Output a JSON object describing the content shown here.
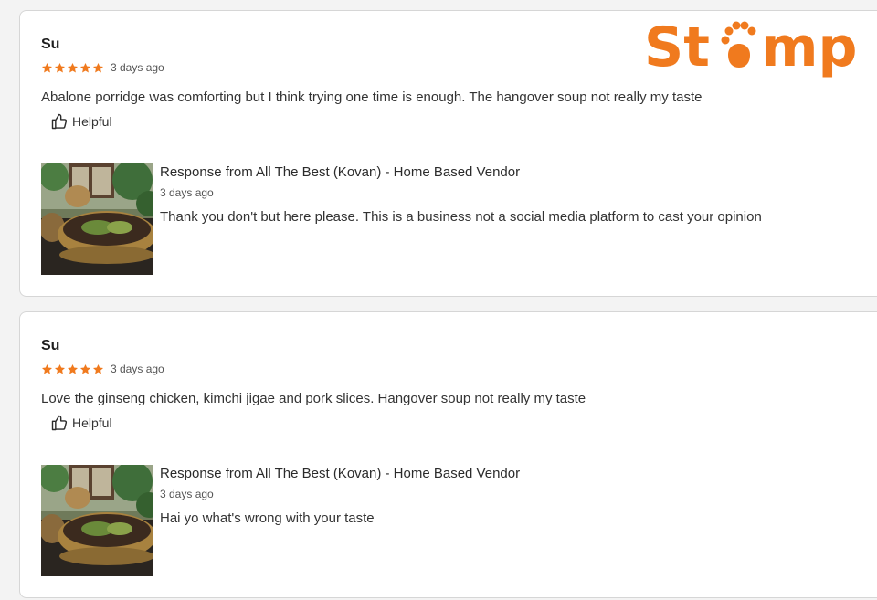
{
  "brand": {
    "logo_text": "Stomp",
    "color": "#f07a1e"
  },
  "colors": {
    "star": "#f07a1e",
    "card_border": "#d6d6d6",
    "card_bg": "#ffffff"
  },
  "reviews": [
    {
      "author": "Su",
      "rating": 5,
      "date": "3 days ago",
      "text": "Abalone porridge was comforting but I think trying one time is enough. The hangover soup not really my taste",
      "helpful_label": "Helpful",
      "response": {
        "title": "Response from All The Best (Kovan) - Home Based Vendor",
        "date": "3 days ago",
        "text": "Thank you don't but here please. This is a business not a social media platform to cast your opinion"
      }
    },
    {
      "author": "Su",
      "rating": 5,
      "date": "3 days ago",
      "text": "Love the ginseng chicken, kimchi jigae and pork slices. Hangover soup not really my taste",
      "helpful_label": "Helpful",
      "response": {
        "title": "Response from All The Best (Kovan) - Home Based Vendor",
        "date": "3 days ago",
        "text": "Hai yo what's wrong with your taste"
      }
    }
  ]
}
